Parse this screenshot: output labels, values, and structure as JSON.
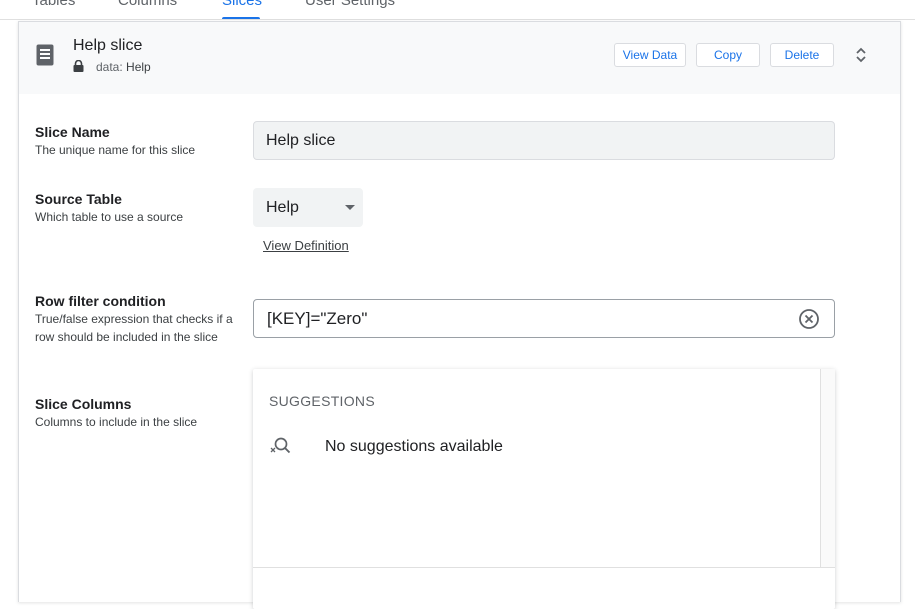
{
  "tabs": [
    {
      "label": "Tables"
    },
    {
      "label": "Columns"
    },
    {
      "label": "Slices"
    },
    {
      "label": "User Settings"
    }
  ],
  "header": {
    "title": "Help slice",
    "data_prefix": "data:",
    "data_value": "Help",
    "view_data_label": "View Data",
    "copy_label": "Copy",
    "delete_label": "Delete"
  },
  "form": {
    "slice_name": {
      "label": "Slice Name",
      "desc": "The unique name for this slice",
      "value": "Help slice"
    },
    "source_table": {
      "label": "Source Table",
      "desc": "Which table to use a source",
      "value": "Help",
      "view_definition": "View Definition"
    },
    "row_filter": {
      "label": "Row filter condition",
      "desc": "True/false expression that checks if a row should be included in the slice",
      "value": "[KEY]=\"Zero\""
    },
    "slice_columns": {
      "label": "Slice Columns",
      "desc": "Columns to include in the slice"
    }
  },
  "suggestions": {
    "heading": "SUGGESTIONS",
    "empty_text": "No suggestions available"
  },
  "colors": {
    "accent": "#1a73e8",
    "header_bg": "#f8f9fa"
  },
  "icons": [
    "book-icon",
    "lock-icon",
    "expand-collapse-icon",
    "clear-circle-icon",
    "search-off-icon",
    "dropdown-caret-icon"
  ]
}
